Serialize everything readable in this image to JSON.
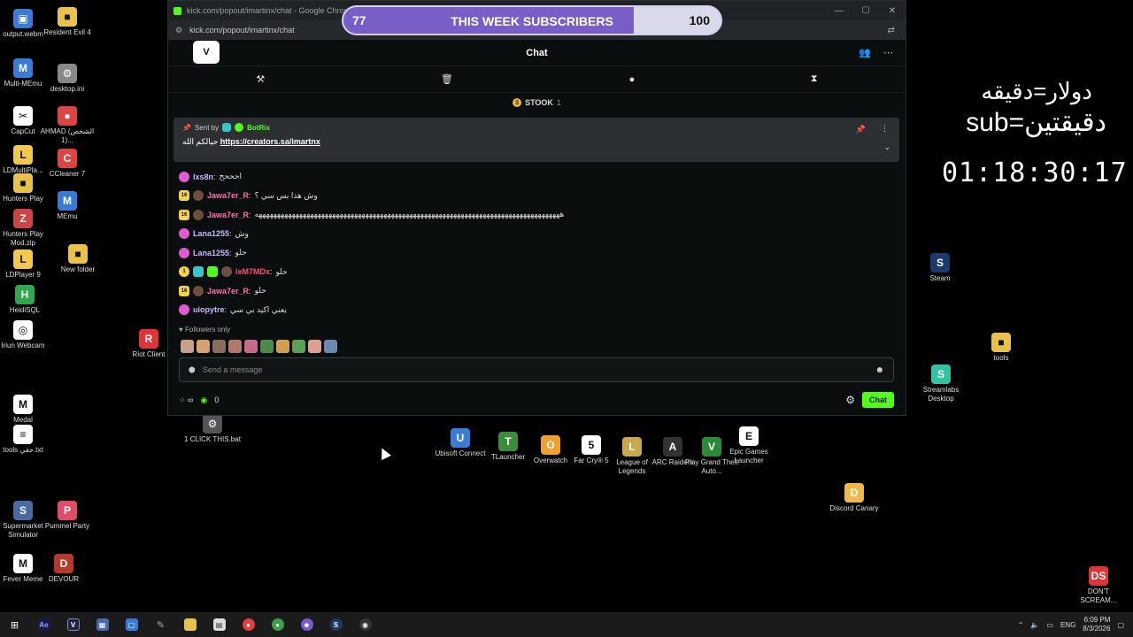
{
  "desktop_icons_left": [
    {
      "label": "output.webm",
      "color": "#3a7bd5",
      "glyph": "▣"
    },
    {
      "label": "Resident Evil 4",
      "color": "#e8c24a",
      "glyph": "■"
    },
    {
      "label": "Multi-MEmu",
      "color": "#3a7bd5",
      "glyph": "M"
    },
    {
      "label": "desktop.ini",
      "color": "#888888",
      "glyph": "⚙"
    },
    {
      "label": "CapCut",
      "color": "#ffffff",
      "glyph": "✂"
    },
    {
      "label": "AHMAD (الشخص 1)...",
      "color": "#dd4444",
      "glyph": "●"
    },
    {
      "label": "LDMultiPla...",
      "color": "#f2c94c",
      "glyph": "L"
    },
    {
      "label": "CCleaner 7",
      "color": "#dd4444",
      "glyph": "C"
    },
    {
      "label": "Hunters Play",
      "color": "#e8c24a",
      "glyph": "■"
    },
    {
      "label": "MEmu",
      "color": "#3a7bd5",
      "glyph": "M"
    },
    {
      "label": "Hunters Play Mod.zip",
      "color": "#c44",
      "glyph": "Z"
    },
    {
      "label": "LDPlayer 9",
      "color": "#f2c94c",
      "glyph": "L"
    },
    {
      "label": "New folder",
      "color": "#e8c24a",
      "glyph": "■"
    },
    {
      "label": "HeidiSQL",
      "color": "#2fa84f",
      "glyph": "H"
    },
    {
      "label": "Iriun Webcam",
      "color": "#ffffff",
      "glyph": "◎"
    },
    {
      "label": "Riot Client",
      "color": "#e0333a",
      "glyph": "R"
    },
    {
      "label": "Medal",
      "color": "#ffffff",
      "glyph": "M"
    },
    {
      "label": "1 CLICK THIS.bat",
      "color": "#555555",
      "glyph": "⚙"
    },
    {
      "label": "tools حقي.txt",
      "color": "#ffffff",
      "glyph": "≡"
    },
    {
      "label": "Supermarket Simulator",
      "color": "#4a6aa5",
      "glyph": "S"
    },
    {
      "label": "Pummel Party",
      "color": "#e04b6a",
      "glyph": "P"
    },
    {
      "label": "Fever Meme",
      "color": "#ffffff",
      "glyph": "M"
    },
    {
      "label": "DEVOUR",
      "color": "#b53a2a",
      "glyph": "D"
    }
  ],
  "desktop_icons_right": [
    {
      "label": "Steam",
      "color": "#1b3a6b",
      "glyph": "S"
    },
    {
      "label": "tools",
      "color": "#e8c24a",
      "glyph": "■"
    },
    {
      "label": "Streamlabs Desktop",
      "color": "#31c3a2",
      "glyph": "S"
    },
    {
      "label": "Discord Canary",
      "color": "#f2b84b",
      "glyph": "D"
    },
    {
      "label": "DON'T SCREAM...",
      "color": "#e0333a",
      "glyph": "DS"
    }
  ],
  "desktop_icons_bottom": [
    {
      "label": "Ubisoft Connect",
      "color": "#3a7bd5",
      "glyph": "U"
    },
    {
      "label": "TLauncher",
      "color": "#3b8c3b",
      "glyph": "T"
    },
    {
      "label": "Overwatch",
      "color": "#f0a030",
      "glyph": "O"
    },
    {
      "label": "Far Cry® 5",
      "color": "#ffffff",
      "glyph": "5"
    },
    {
      "label": "League of Legends",
      "color": "#c8a84b",
      "glyph": "L"
    },
    {
      "label": "ARC Raiders",
      "color": "#333333",
      "glyph": "A"
    },
    {
      "label": "Play Grand Theft Auto...",
      "color": "#2a8a3a",
      "glyph": "V"
    },
    {
      "label": "Epic Games Launcher",
      "color": "#ffffff",
      "glyph": "E"
    }
  ],
  "browser": {
    "title": "kick.com/popout/imartinx/chat - Google Chrome",
    "url": "kick.com/popout/imartinx/chat"
  },
  "chat": {
    "header_title": "Chat",
    "channel_logo": "V",
    "goal_label": "STOOK",
    "goal_count": "1",
    "pinned": {
      "sent_by_label": "Sent by",
      "bot_name": "BotRix",
      "message_prefix": "حيالكم الله",
      "message_link": "https://creators.sa/imartnx"
    },
    "messages": [
      {
        "badges": [
          "pink"
        ],
        "username": "lxs8n",
        "user_color": "#c9b6ff",
        "text": "احححح"
      },
      {
        "badges": [
          "sub",
          "avatar"
        ],
        "username": "Jawa7er_R",
        "user_color": "#ff6fa4",
        "text": "وش هذا بس سي ؟"
      },
      {
        "badges": [
          "sub",
          "avatar"
        ],
        "username": "Jawa7er_R",
        "user_color": "#ff6fa4",
        "text": "هههههههههههههههههههههههههههههههههههههههههههههههههههههههههههههههههههههههههههههههههههه"
      },
      {
        "badges": [
          "pink"
        ],
        "username": "Lana1255",
        "user_color": "#c9b6ff",
        "text": "وش"
      },
      {
        "badges": [
          "pink"
        ],
        "username": "Lana1255",
        "user_color": "#c9b6ff",
        "text": "حلو"
      },
      {
        "badges": [
          "coin",
          "cyan",
          "green",
          "avatar"
        ],
        "username": "ixM7MDx",
        "user_color": "#ff4d6d",
        "text": "حلو"
      },
      {
        "badges": [
          "sub",
          "avatar"
        ],
        "username": "Jawa7er_R",
        "user_color": "#ff6fa4",
        "text": "حلو"
      },
      {
        "badges": [
          "pink"
        ],
        "username": "uiopytre",
        "user_color": "#c9b6ff",
        "text": "يعني اكيد بي سي"
      }
    ],
    "followers_only": "Followers only",
    "input_placeholder": "Send a message",
    "viewer_count": "0",
    "chat_button": "Chat"
  },
  "sub_goal": {
    "current": "77",
    "label": "THIS WEEK SUBSCRIBERS",
    "target": "100",
    "progress": 0.77
  },
  "overlay": {
    "rate_line1": "دولار=دقيقه",
    "rate_line2": "sub=دقيقتين",
    "timer": "01:18:30:17"
  },
  "taskbar": {
    "language": "ENG",
    "time": "6:09 PM",
    "date": "8/3/2026"
  }
}
